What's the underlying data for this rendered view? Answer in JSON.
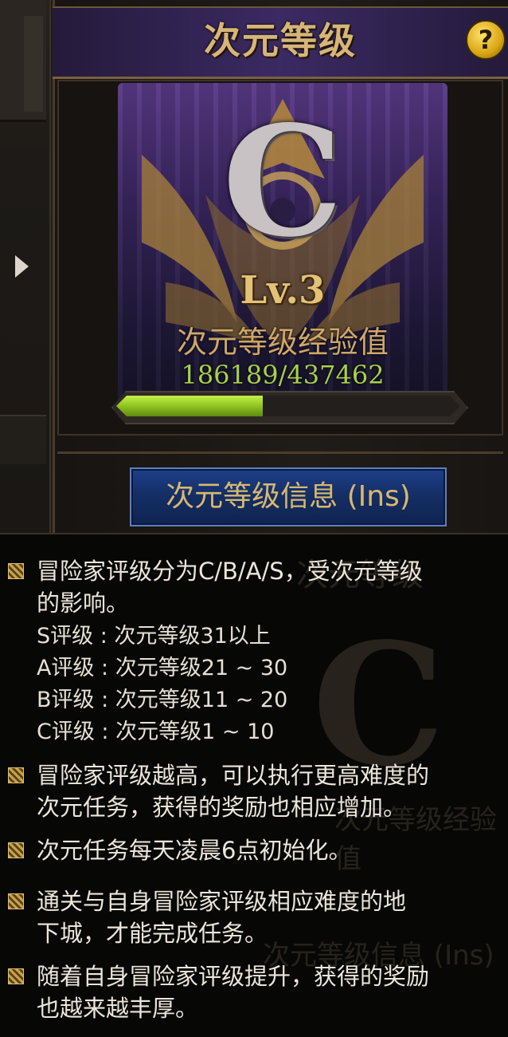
{
  "panel": {
    "title": "次元等级",
    "help_label": "?",
    "help_icon": "question-icon",
    "grade_letter": "C",
    "level": "Lv.3",
    "exp_label": "次元等级经验值",
    "exp_value": "186189/437462",
    "exp_current": 186189,
    "exp_max": 437462,
    "info_button_label": "次元等级信息 (Ins)",
    "side_arrow_icon": "triangle-right-icon",
    "colors": {
      "title": "#d7b577",
      "exp_value": "#a8d14a",
      "bar_fill": "#8fc420",
      "button": "#142d63"
    }
  },
  "tooltip": {
    "items": [
      {
        "lines": [
          "冒险家评级分为C/B/A/S，受次元等级",
          "的影响。"
        ]
      },
      {
        "lines": [
          "冒险家评级越高，可以执行更高难度的",
          "次元任务，获得的奖励也相应增加。"
        ]
      },
      {
        "lines": [
          "次元任务每天凌晨6点初始化。"
        ]
      },
      {
        "lines": [
          "通关与自身冒险家评级相应难度的地",
          "下城，才能完成任务。"
        ]
      },
      {
        "lines": [
          "随着自身冒险家评级提升，获得的奖励",
          "也越来越丰厚。"
        ]
      }
    ],
    "grades": [
      "S评级 : 次元等级31以上",
      "A评级 : 次元等级21 ~ 30",
      "B评级 : 次元等级11 ~ 20",
      "C评级 : 次元等级1 ~ 10"
    ],
    "bullet_icon": "bullet-diamond-icon"
  }
}
